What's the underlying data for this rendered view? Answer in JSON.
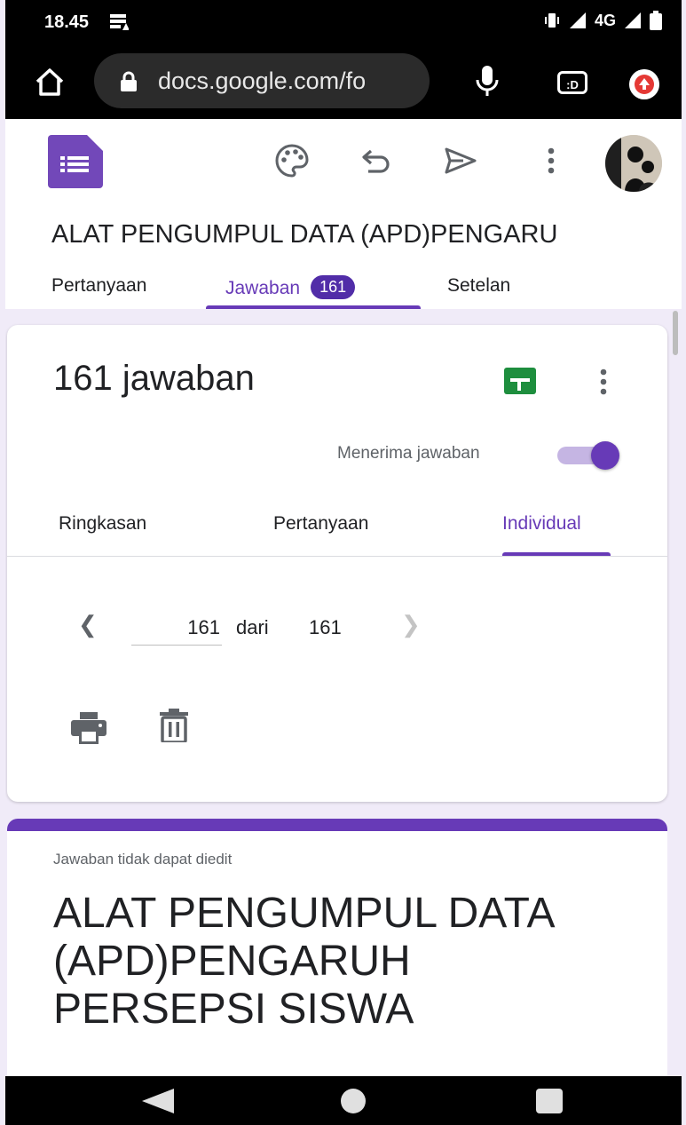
{
  "status_bar": {
    "time": "18.45",
    "network": "4G"
  },
  "browser": {
    "url": "docs.google.com/fo",
    "tabs_badge": ":D"
  },
  "form": {
    "title_truncated": "ALAT PENGUMPUL DATA (APD)PENGARU",
    "tabs": [
      {
        "label": "Pertanyaan"
      },
      {
        "label": "Jawaban",
        "badge": "161"
      },
      {
        "label": "Setelan"
      }
    ],
    "active_tab": "Jawaban"
  },
  "responses": {
    "count_label": "161 jawaban",
    "accepting_label": "Menerima jawaban",
    "accepting": true,
    "subtabs": [
      {
        "label": "Ringkasan"
      },
      {
        "label": "Pertanyaan"
      },
      {
        "label": "Individual"
      }
    ],
    "active_subtab": "Individual",
    "pager": {
      "current": "161",
      "of_label": "dari",
      "total": "161"
    }
  },
  "response_card": {
    "notice": "Jawaban tidak dapat diedit",
    "title": "ALAT PENGUMPUL DATA (APD)PENGARUH PERSEPSI SISWA"
  },
  "colors": {
    "accent": "#673ab7",
    "badge": "#512da8",
    "sheets_green": "#1e8e3e"
  }
}
